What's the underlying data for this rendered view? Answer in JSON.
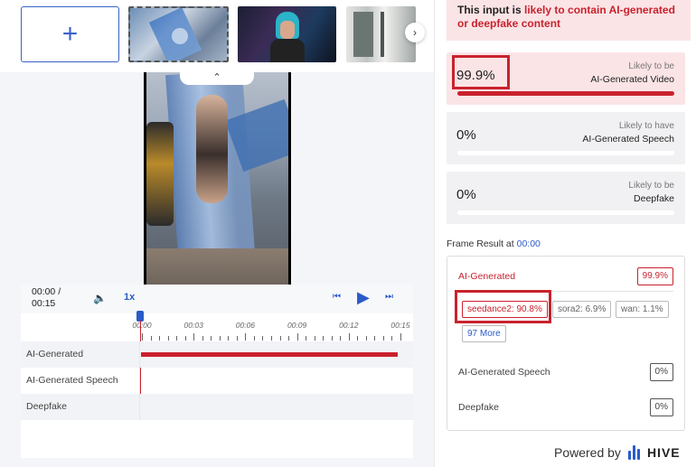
{
  "thumbnails": {
    "add_icon": "+",
    "next_icon": "›",
    "items": [
      "firefighter-slide",
      "cyber-woman",
      "interior-window"
    ]
  },
  "video": {
    "collapse_icon": "⌃"
  },
  "player": {
    "time_current": "00:00 /",
    "time_total": "00:15",
    "speed": "1x",
    "volume_icon": "🔈",
    "prev_icon": "⏮",
    "play_icon": "▶",
    "next_icon": "⏭",
    "ticks": [
      "00:00",
      "00:03",
      "00:06",
      "00:09",
      "00:12",
      "00:15"
    ],
    "tracks": [
      {
        "label": "AI-Generated",
        "fill": 1.0
      },
      {
        "label": "AI-Generated Speech",
        "fill": 0
      },
      {
        "label": "Deepfake",
        "fill": 0
      }
    ],
    "accent_color": "#2a5bc8",
    "track_color": "#c9222e"
  },
  "summary": {
    "banner_prefix": "This input is ",
    "banner_highlight": "likely to contain AI-generated or deepfake content",
    "cards": [
      {
        "pct": "99.9%",
        "line1": "Likely to be",
        "line2": "AI-Generated Video",
        "fill": 0.999
      },
      {
        "pct": "0%",
        "line1": "Likely to have",
        "line2": "AI-Generated Speech",
        "fill": 0
      },
      {
        "pct": "0%",
        "line1": "Likely to be",
        "line2": "Deepfake",
        "fill": 0
      }
    ]
  },
  "frame": {
    "title": "Frame Result at ",
    "time": "00:00",
    "ai_label": "AI-Generated",
    "ai_value": "99.9%",
    "chips": [
      "seedance2: 90.8%",
      "sora2: 6.9%",
      "wan: 1.1%",
      "97 More"
    ],
    "speech_label": "AI-Generated Speech",
    "speech_value": "0%",
    "deepfake_label": "Deepfake",
    "deepfake_value": "0%"
  },
  "footer": {
    "powered_by": "Powered by",
    "brand": "HIVE"
  }
}
